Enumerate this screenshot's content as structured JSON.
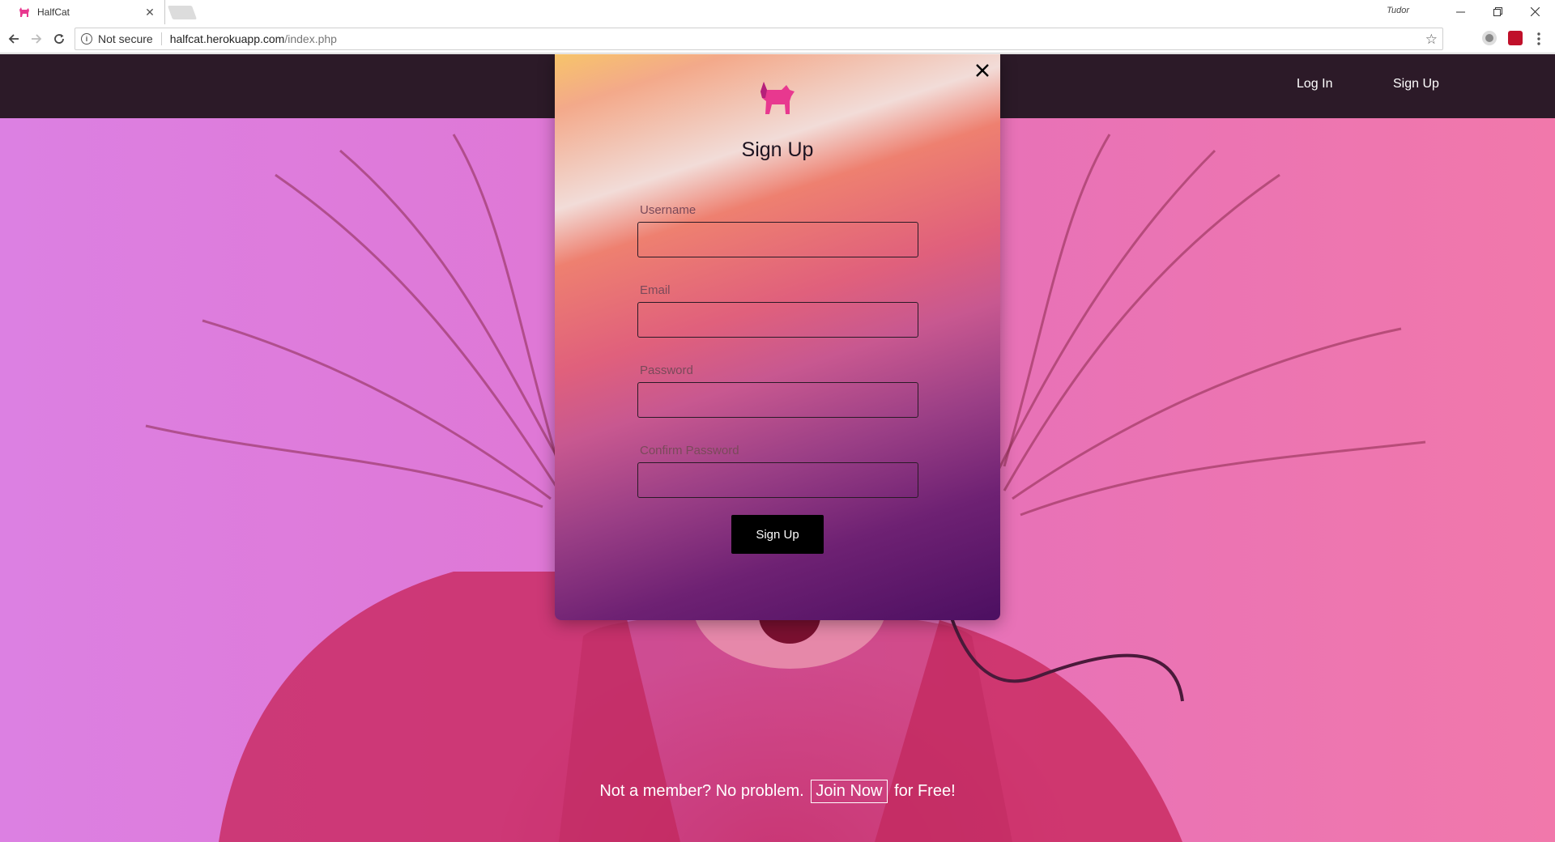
{
  "browser": {
    "tab_title": "HalfCat",
    "profile_name": "Tudor",
    "security_label": "Not secure",
    "url_host": "halfcat.herokuapp.com",
    "url_path": "/index.php"
  },
  "site_nav": {
    "login_label": "Log In",
    "signup_label": "Sign Up"
  },
  "modal": {
    "title": "Sign Up",
    "fields": [
      {
        "label": "Username",
        "value": ""
      },
      {
        "label": "Email",
        "value": ""
      },
      {
        "label": "Password",
        "value": ""
      },
      {
        "label": "Confirm Password",
        "value": ""
      }
    ],
    "submit_label": "Sign Up"
  },
  "cta": {
    "prefix": "Not a member? No problem.",
    "link": "Join Now",
    "suffix": "for Free!"
  },
  "colors": {
    "nav_bg": "#2c1a28",
    "brand_pink": "#e8388f",
    "button_bg": "#000000"
  }
}
